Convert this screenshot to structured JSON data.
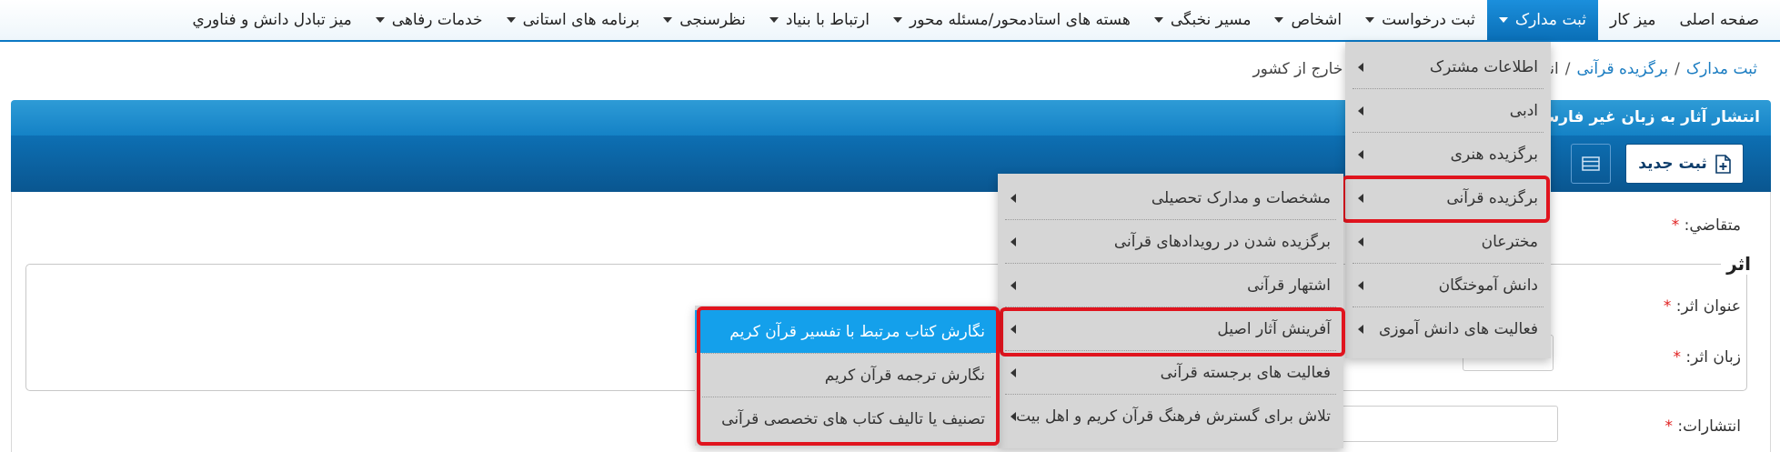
{
  "nav": {
    "items": [
      {
        "label": "صفحه اصلی",
        "has_caret": false,
        "active": false
      },
      {
        "label": "میز کار",
        "has_caret": false,
        "active": false
      },
      {
        "label": "ثبت مدارک",
        "has_caret": true,
        "active": true
      },
      {
        "label": "ثبت درخواست",
        "has_caret": true,
        "active": false
      },
      {
        "label": "اشخاص",
        "has_caret": true,
        "active": false
      },
      {
        "label": "مسیر نخبگی",
        "has_caret": true,
        "active": false
      },
      {
        "label": "هسته های استادمحور/مسئله محور",
        "has_caret": true,
        "active": false
      },
      {
        "label": "ارتباط با بنیاد",
        "has_caret": true,
        "active": false
      },
      {
        "label": "نظرسنجی",
        "has_caret": true,
        "active": false
      },
      {
        "label": "برنامه های استانی",
        "has_caret": true,
        "active": false
      },
      {
        "label": "خدمات رفاهی",
        "has_caret": true,
        "active": false
      },
      {
        "label": "میز تبادل دانش و فناوري",
        "has_caret": false,
        "active": false
      }
    ]
  },
  "breadcrumb": {
    "root": "ثبت مدارک",
    "parent": "برگزیده قرآنی",
    "current": "انتشار آثار به زبان غیر فارسی در خارج از کشور"
  },
  "panel": {
    "title": "انتشار آثار به زبان غیر فارسی در خارج از کشور",
    "new_button": "ثبت جدید"
  },
  "form": {
    "applicant_label": "متقاضي:",
    "section_legend": "اثر",
    "work_title_label": "عنوان اثر:",
    "work_language_label": "زبان اثر:",
    "publisher_label": "انتشارات:",
    "required_mark": "*"
  },
  "menus": {
    "level1": [
      "اطلاعات مشترک",
      "ادبی",
      "برگزیده هنری",
      "برگزیده قرآنی",
      "مخترعان",
      "دانش آموختگان",
      "فعالیت های دانش آموزی"
    ],
    "level2": [
      "مشخصات و مدارک تحصیلی",
      "برگزیده شدن در رویدادهای قرآنی",
      "اشتهار قرآنی",
      "آفرینش آثار اصیل",
      "فعالیت های برجسته قرآنی",
      "تلاش برای گسترش فرهنگ قرآن کریم و اهل بیت"
    ],
    "level3": [
      "نگارش کتاب مرتبط با تفسیر قرآن کریم",
      "نگارش ترجمه قرآن کریم",
      "تصنیف یا تالیف کتاب های تخصصی قرآنی"
    ]
  },
  "colors": {
    "accent": "#0b78c4",
    "highlight": "#14a0eb",
    "annotation": "#e0141e",
    "required": "#e02020"
  },
  "icons": {
    "new_button": "file-plus-icon",
    "list_button": "list-icon",
    "menu_arrow": "triangle-left-icon",
    "nav_caret": "caret-down-icon"
  }
}
